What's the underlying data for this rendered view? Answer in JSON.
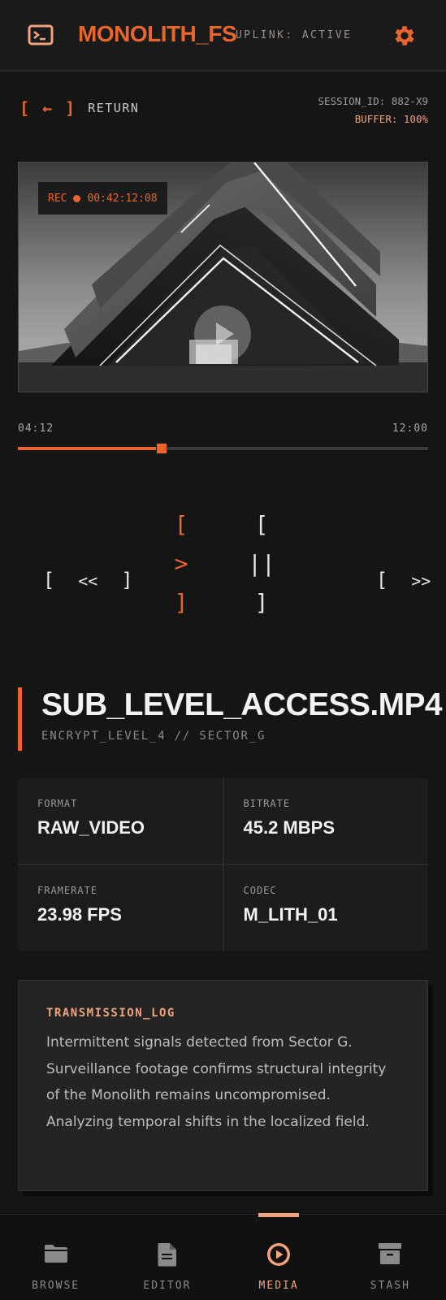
{
  "header": {
    "app_title": "MONOLITH_FS",
    "uplink_status": "UPLINK: ACTIVE",
    "icons": {
      "left": "terminal-icon",
      "right": "gear-icon"
    }
  },
  "return_bar": {
    "return_glyph": "[ ← ]",
    "return_label": "RETURN",
    "session_id": "SESSION_ID: 882-X9",
    "buffer": "BUFFER: 100%"
  },
  "video": {
    "rec_label": "REC",
    "rec_timecode": "00:42:12:08",
    "overlay_icon": "play-icon"
  },
  "timeline": {
    "current": "04:12",
    "total": "12:00",
    "progress": 0.35
  },
  "controls": {
    "rewind": [
      "[",
      "<<",
      "]"
    ],
    "play": [
      "[",
      ">",
      "]"
    ],
    "pause": [
      "[",
      "||",
      "]"
    ],
    "forward": [
      "[",
      ">>",
      "]"
    ]
  },
  "file": {
    "name": "SUB_LEVEL_ACCESS.MP4",
    "subtitle": "ENCRYPT_LEVEL_4 // SECTOR_G"
  },
  "stats": [
    {
      "label": "FORMAT",
      "value": "RAW_VIDEO"
    },
    {
      "label": "BITRATE",
      "value": "45.2 MBPS"
    },
    {
      "label": "FRAMERATE",
      "value": "23.98 FPS"
    },
    {
      "label": "CODEC",
      "value": "M_LITH_01"
    }
  ],
  "log": {
    "title": "TRANSMISSION_LOG",
    "body": "Intermittent signals detected from Sector G. Surveillance footage confirms structural integrity of the Monolith remains uncompromised. Analyzing temporal shifts in the localized field."
  },
  "nav": [
    {
      "label": "BROWSE",
      "icon": "folder-icon"
    },
    {
      "label": "EDITOR",
      "icon": "document-icon"
    },
    {
      "label": "MEDIA",
      "icon": "play-circle-icon",
      "active": true
    },
    {
      "label": "STASH",
      "icon": "archive-icon"
    }
  ],
  "colors": {
    "accent": "#e8652c",
    "accent_soft": "#f0a37c",
    "background": "#151515"
  }
}
